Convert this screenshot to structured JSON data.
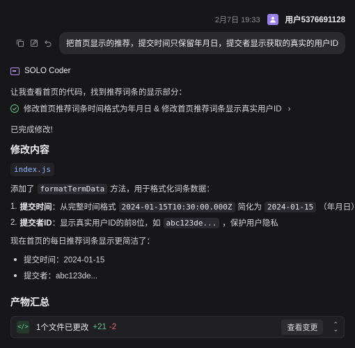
{
  "message": {
    "time": "2月7日 19:33",
    "user": "用户5376691128",
    "text": "把首页显示的推荐，提交时间只保留年月日，提交者显示获取的真实的用户ID"
  },
  "agent": {
    "name": "SOLO Coder",
    "intro": "让我查看首页的代码，找到推荐词条的显示部分：",
    "task": "修改首页推荐词条时间格式为年月日 & 修改首页推荐词条显示真实用户ID",
    "done": "已完成修改!"
  },
  "changes": {
    "heading": "修改内容",
    "file": "index.js",
    "added_prefix": "添加了",
    "method": "formatTermData",
    "added_suffix": "方法，用于格式化词条数据：",
    "item1": {
      "num": "1.",
      "label": "提交时间",
      "text_a": "：从完整时间格式",
      "code_a": "2024-01-15T10:30:00.000Z",
      "text_b": "简化为",
      "code_b": "2024-01-15",
      "text_c": "（年月日）"
    },
    "item2": {
      "num": "2.",
      "label": "提交者ID",
      "text_a": "：显示真实用户ID的前8位，如",
      "code_a": "abc123de...",
      "text_b": "，保护用户隐私"
    },
    "summary": "现在首页的每日推荐词条显示更简洁了：",
    "bullets": [
      "提交时间：2024-01-15",
      "提交者：abc123de..."
    ]
  },
  "artifacts": {
    "heading": "产物汇总",
    "label": "1个文件已更改",
    "added": "+21",
    "removed": "-2",
    "view_button": "查看变更"
  }
}
